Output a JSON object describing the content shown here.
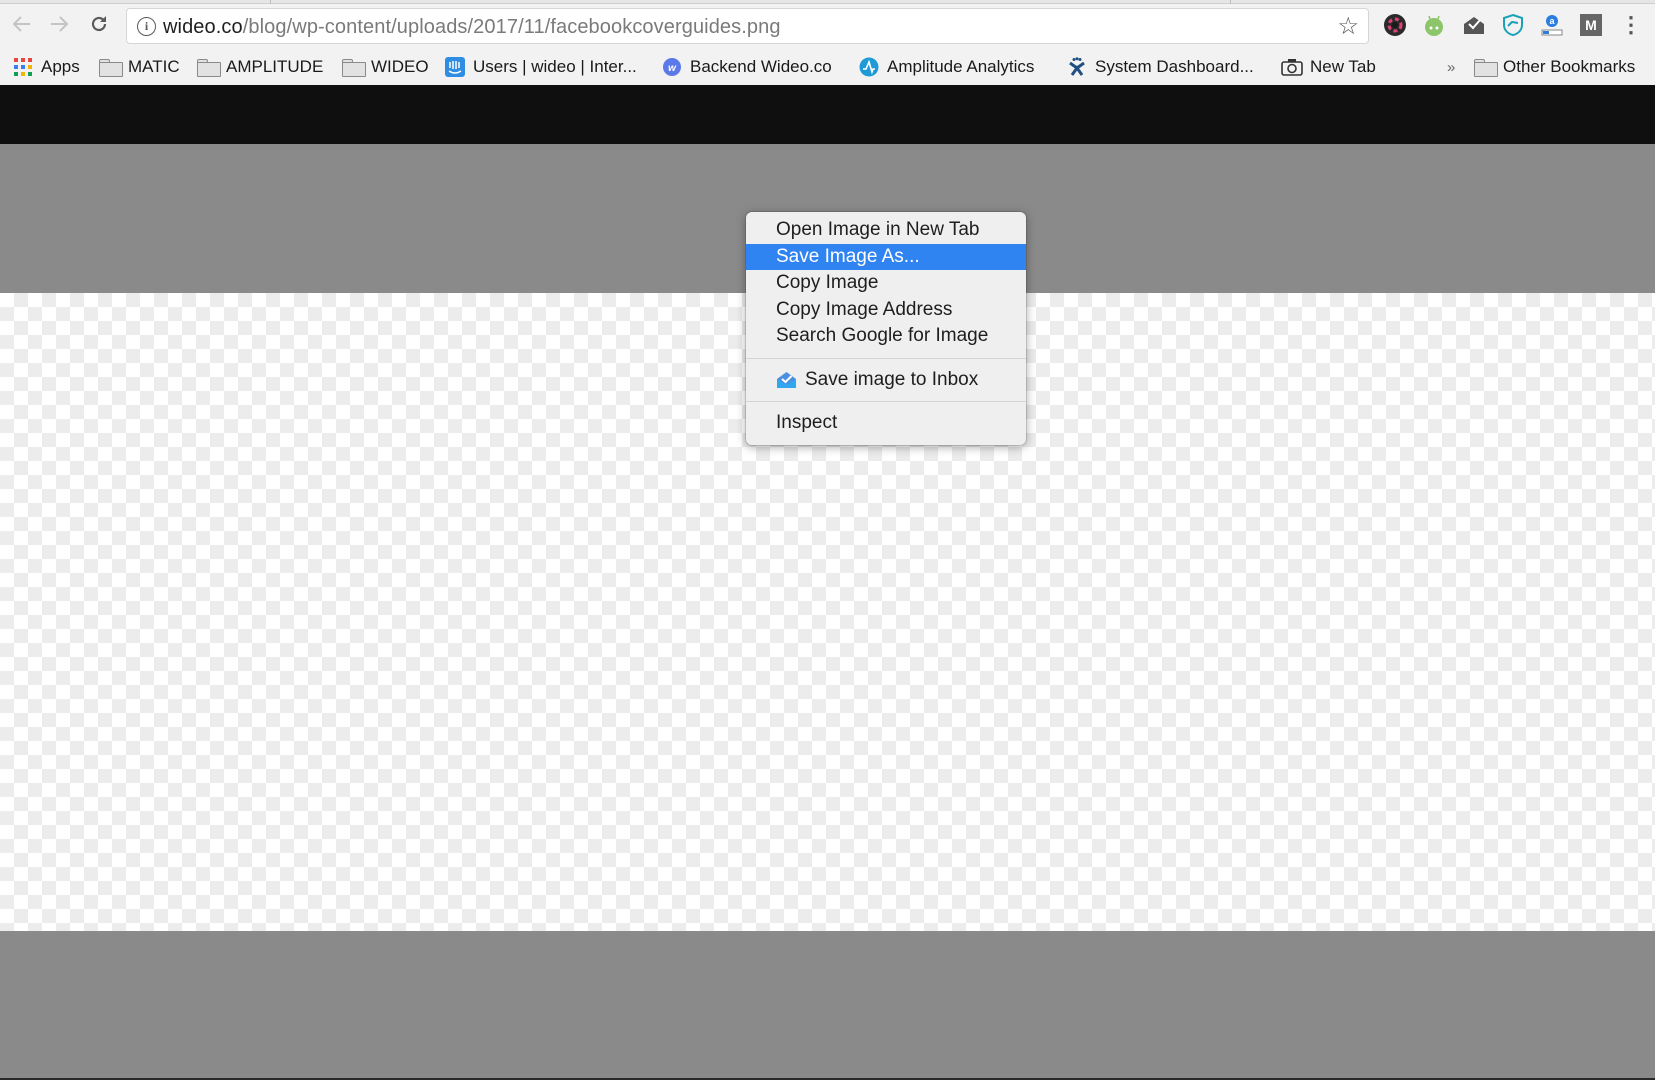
{
  "browser": {
    "nav": {
      "back_icon": "arrow-left-icon",
      "forward_icon": "arrow-right-icon",
      "reload_icon": "reload-icon"
    },
    "omnibox": {
      "url_host": "wideo.co",
      "url_path": "/blog/wp-content/uploads/2017/11/facebookcoverguides.png",
      "info_glyph": "i",
      "star_glyph": "☆"
    },
    "extensions": [
      {
        "name": "color-picker-extension",
        "color": "#333333"
      },
      {
        "name": "android-bot-extension",
        "color": "#8cc56a"
      },
      {
        "name": "inbox-checkmark-extension",
        "color": "#555555"
      },
      {
        "name": "shield-extension",
        "color": "#1aa3b8"
      },
      {
        "name": "amazon-assistant-extension",
        "color": "#2b7de0"
      },
      {
        "name": "m-extension",
        "color": "#666666"
      }
    ],
    "menu_glyph": "⋮",
    "bookmarks": [
      {
        "label": "Apps",
        "icon": "apps-grid-icon"
      },
      {
        "label": "MATIC",
        "icon": "folder-icon"
      },
      {
        "label": "AMPLITUDE",
        "icon": "folder-icon"
      },
      {
        "label": "WIDEO",
        "icon": "folder-icon"
      },
      {
        "label": "Users | wideo | Inter...",
        "icon": "intercom-icon"
      },
      {
        "label": "Backend Wideo.co",
        "icon": "wideo-icon"
      },
      {
        "label": "Amplitude Analytics",
        "icon": "amplitude-icon"
      },
      {
        "label": "System Dashboard...",
        "icon": "jira-icon"
      },
      {
        "label": "New Tab",
        "icon": "camera-icon"
      }
    ],
    "overflow_glyph": "»",
    "other_bookmarks": "Other Bookmarks"
  },
  "context_menu": {
    "items": [
      {
        "label": "Open Image in New Tab"
      },
      {
        "label": "Save Image As...",
        "highlighted": true
      },
      {
        "label": "Copy Image"
      },
      {
        "label": "Copy Image Address"
      },
      {
        "label": "Search Google for Image"
      }
    ],
    "extension_item": {
      "label": "Save image to Inbox",
      "icon": "inbox-icon"
    },
    "inspect_item": {
      "label": "Inspect"
    }
  },
  "colors": {
    "highlight": "#2f84f2",
    "page_gray": "#8a8a8a",
    "top_band": "#0f0f0f"
  }
}
